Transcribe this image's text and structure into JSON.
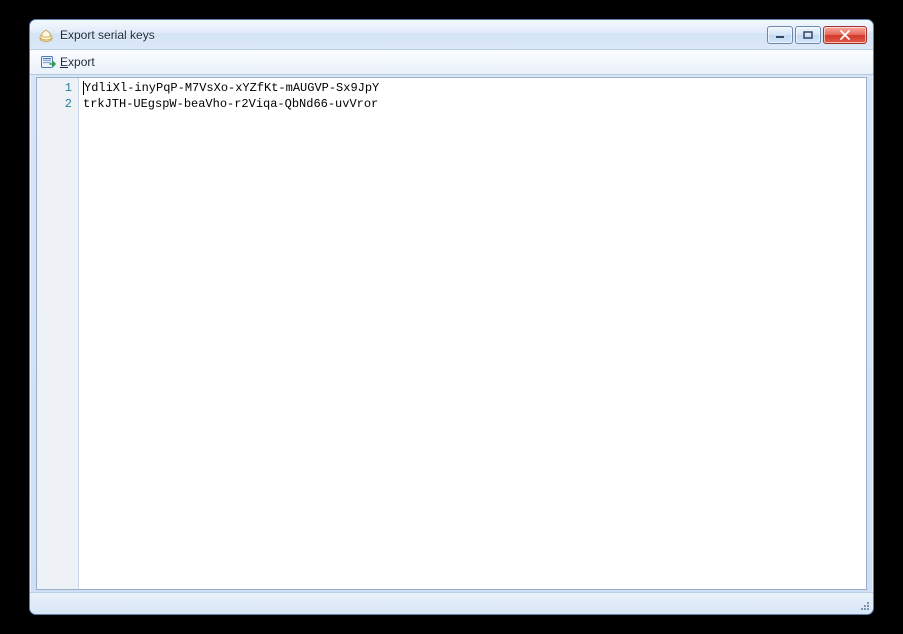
{
  "window": {
    "title": "Export serial keys"
  },
  "toolbar": {
    "export": {
      "label": "Export",
      "mnemonic_index": 0
    }
  },
  "editor": {
    "lines": [
      "YdliXl-inyPqP-M7VsXo-xYZfKt-mAUGVP-Sx9JpY",
      "trkJTH-UEgspW-beaVho-r2Viqa-QbNd66-uvVror"
    ]
  }
}
